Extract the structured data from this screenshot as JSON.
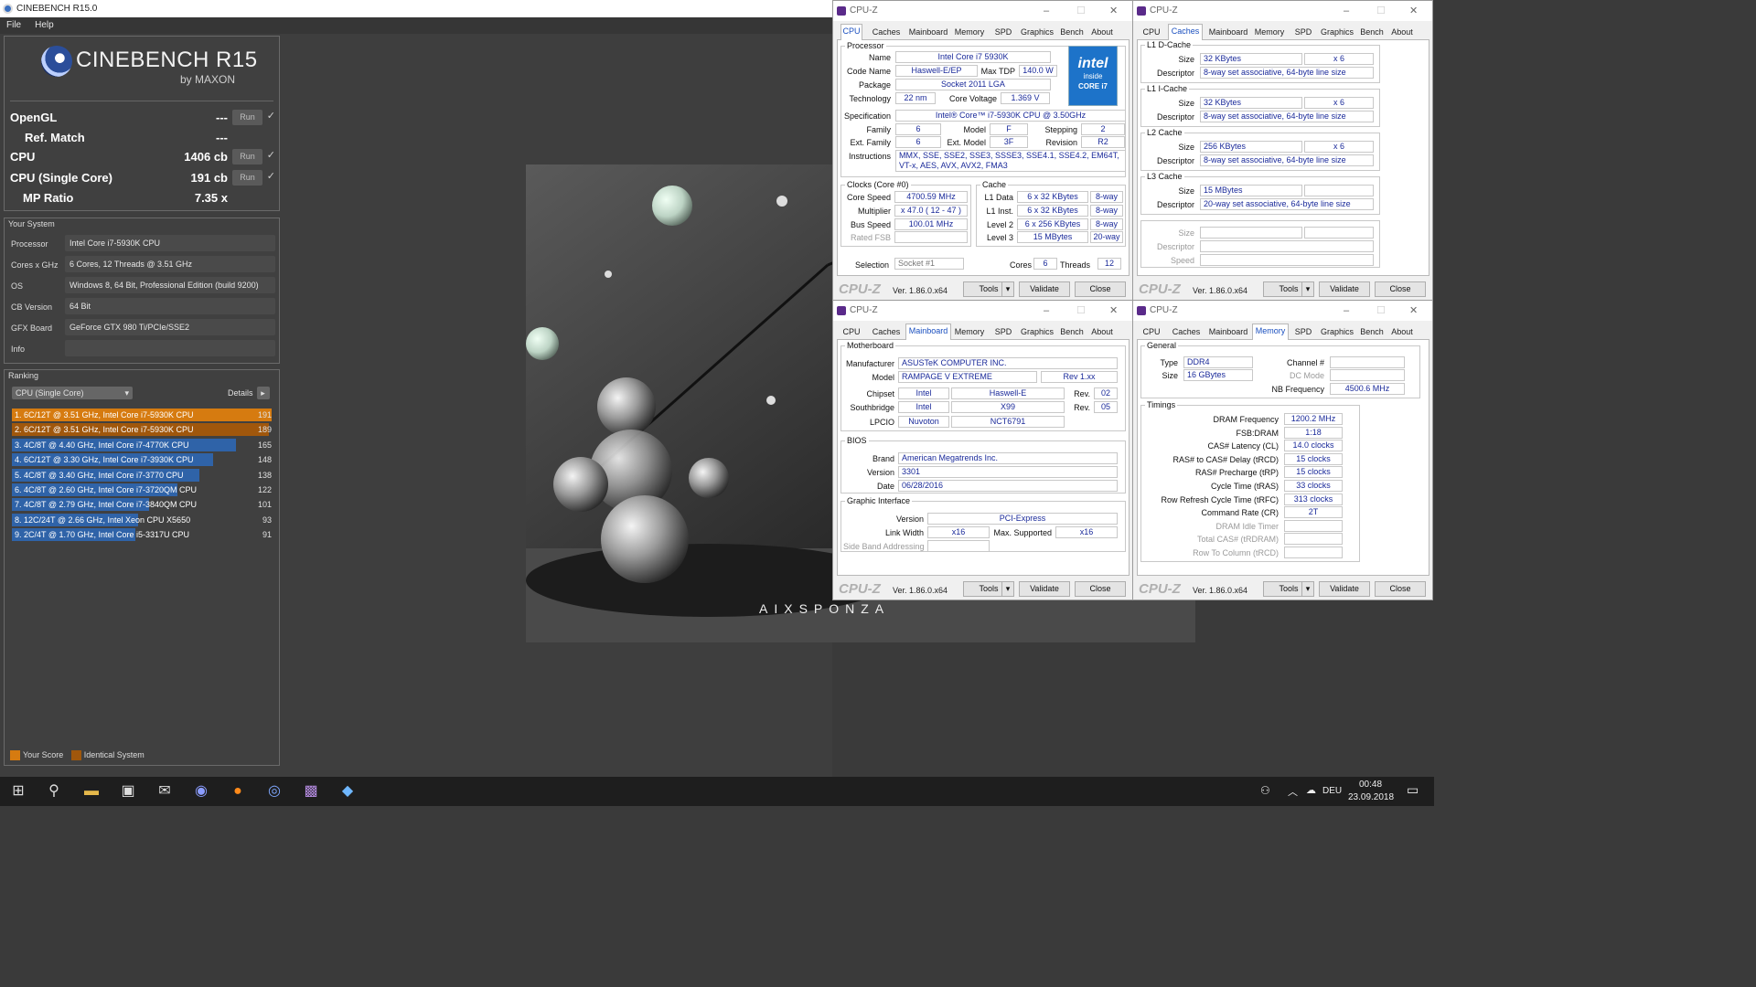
{
  "cinebench": {
    "title": "CINEBENCH R15.0",
    "menu": [
      "File",
      "Help"
    ],
    "logo": {
      "name": "CINEBENCH R15",
      "by": "by MAXON"
    },
    "scores": [
      {
        "label": "OpenGL",
        "value": "---",
        "run": "Run",
        "check": "✓"
      },
      {
        "label": "Ref. Match",
        "value": "---"
      },
      {
        "label": "CPU",
        "value": "1406 cb",
        "run": "Run",
        "check": "✓"
      },
      {
        "label": "CPU (Single Core)",
        "value": "191 cb",
        "run": "Run",
        "check": "✓"
      },
      {
        "label": "MP Ratio",
        "value": "7.35 x"
      }
    ],
    "your_system": {
      "title": "Your System",
      "rows": [
        {
          "k": "Processor",
          "v": "Intel Core i7-5930K CPU"
        },
        {
          "k": "Cores x GHz",
          "v": "6 Cores, 12 Threads @ 3.51 GHz"
        },
        {
          "k": "OS",
          "v": "Windows 8, 64 Bit, Professional Edition (build 9200)"
        },
        {
          "k": "CB Version",
          "v": "64 Bit"
        },
        {
          "k": "GFX Board",
          "v": "GeForce GTX 980 Ti/PCIe/SSE2"
        },
        {
          "k": "Info",
          "v": ""
        }
      ]
    },
    "ranking": {
      "title": "Ranking",
      "dropdown": "CPU (Single Core)",
      "details": "Details",
      "items": [
        {
          "text": "1. 6C/12T @ 3.51 GHz, Intel Core i7-5930K CPU",
          "score": "191",
          "value": 191,
          "kind": "your"
        },
        {
          "text": "2. 6C/12T @ 3.51 GHz, Intel Core i7-5930K CPU",
          "score": "189",
          "value": 189,
          "kind": "identical"
        },
        {
          "text": "3. 4C/8T @ 4.40 GHz, Intel Core i7-4770K CPU",
          "score": "165",
          "value": 165,
          "kind": "other"
        },
        {
          "text": "4. 6C/12T @ 3.30 GHz,  Intel Core i7-3930K CPU",
          "score": "148",
          "value": 148,
          "kind": "other"
        },
        {
          "text": "5. 4C/8T @ 3.40 GHz,  Intel Core i7-3770 CPU",
          "score": "138",
          "value": 138,
          "kind": "other"
        },
        {
          "text": "6. 4C/8T @ 2.60 GHz, Intel Core i7-3720QM CPU",
          "score": "122",
          "value": 122,
          "kind": "other"
        },
        {
          "text": "7. 4C/8T @ 2.79 GHz,  Intel Core i7-3840QM CPU",
          "score": "101",
          "value": 101,
          "kind": "other"
        },
        {
          "text": "8. 12C/24T @ 2.66 GHz, Intel Xeon CPU X5650",
          "score": "93",
          "value": 93,
          "kind": "other"
        },
        {
          "text": "9. 2C/4T @ 1.70 GHz,  Intel Core i5-3317U CPU",
          "score": "91",
          "value": 91,
          "kind": "other"
        }
      ]
    },
    "legend": {
      "your": "Your Score",
      "identical": "Identical System"
    },
    "render_brand": "AIXSPONZA",
    "colors": {
      "your": "#d67b10",
      "identical": "#a0570c",
      "other": "#2f63a8"
    }
  },
  "taskbar": {
    "time": "00:48",
    "date": "23.09.2018",
    "lang": "DEU"
  },
  "cpuz": {
    "title": "CPU-Z",
    "tabs": [
      "CPU",
      "Caches",
      "Mainboard",
      "Memory",
      "SPD",
      "Graphics",
      "Bench",
      "About"
    ],
    "version": "Ver. 1.86.0.x64",
    "logo": "CPU-Z",
    "buttons": {
      "tools": "Tools",
      "validate": "Validate",
      "close": "Close"
    },
    "cpu": {
      "processor_group": "Processor",
      "name_l": "Name",
      "name": "Intel Core i7 5930K",
      "codename_l": "Code Name",
      "codename": "Haswell-E/EP",
      "tdp_l": "Max TDP",
      "tdp": "140.0 W",
      "package_l": "Package",
      "package": "Socket 2011 LGA",
      "tech_l": "Technology",
      "tech": "22 nm",
      "voltage_l": "Core Voltage",
      "voltage": "1.369 V",
      "spec_l": "Specification",
      "spec": "Intel® Core™ i7-5930K CPU @ 3.50GHz",
      "family_l": "Family",
      "family": "6",
      "model_l": "Model",
      "model": "F",
      "stepping_l": "Stepping",
      "stepping": "2",
      "extfamily_l": "Ext. Family",
      "extfamily": "6",
      "extmodel_l": "Ext. Model",
      "extmodel": "3F",
      "revision_l": "Revision",
      "revision": "R2",
      "instr_l": "Instructions",
      "instr": "MMX, SSE, SSE2, SSE3, SSSE3, SSE4.1, SSE4.2, EM64T, VT-x, AES, AVX, AVX2, FMA3",
      "clocks_group": "Clocks (Core #0)",
      "cache_group": "Cache",
      "speed_l": "Core Speed",
      "speed": "4700.59 MHz",
      "mult_l": "Multiplier",
      "mult": "x 47.0 ( 12 - 47 )",
      "bus_l": "Bus Speed",
      "bus": "100.01 MHz",
      "fsb_l": "Rated FSB",
      "l1d_l": "L1 Data",
      "l1d": "6 x 32 KBytes",
      "l1d_w": "8-way",
      "l1i_l": "L1 Inst.",
      "l1i": "6 x 32 KBytes",
      "l1i_w": "8-way",
      "l2_l": "Level 2",
      "l2": "6 x 256 KBytes",
      "l2_w": "8-way",
      "l3_l": "Level 3",
      "l3": "15 MBytes",
      "l3_w": "20-way",
      "sel_l": "Selection",
      "sel": "Socket #1",
      "cores_l": "Cores",
      "cores": "6",
      "threads_l": "Threads",
      "threads": "12",
      "intel_badge": {
        "brand": "intel",
        "inside": "inside",
        "line": "CORE i7"
      }
    },
    "caches": {
      "l1d_group": "L1 D-Cache",
      "l1i_group": "L1 I-Cache",
      "l2_group": "L2 Cache",
      "l3_group": "L3 Cache",
      "size_l": "Size",
      "desc_l": "Descriptor",
      "speed_l": "Speed",
      "l1d_size": "32 KBytes",
      "l1d_x": "x 6",
      "l1d_desc": "8-way set associative, 64-byte line size",
      "l1i_size": "32 KBytes",
      "l1i_x": "x 6",
      "l1i_desc": "8-way set associative, 64-byte line size",
      "l2_size": "256 KBytes",
      "l2_x": "x 6",
      "l2_desc": "8-way set associative, 64-byte line size",
      "l3_size": "15 MBytes",
      "l3_desc": "20-way set associative, 64-byte line size"
    },
    "mainboard": {
      "mb_group": "Motherboard",
      "manu_l": "Manufacturer",
      "manu": "ASUSTeK COMPUTER INC.",
      "model_l": "Model",
      "model": "RAMPAGE V EXTREME",
      "rev": "Rev 1.xx",
      "chipset_l": "Chipset",
      "chipset": "Intel",
      "chipset2": "Haswell-E",
      "rev_l": "Rev.",
      "chipset_rev": "02",
      "sb_l": "Southbridge",
      "sb": "Intel",
      "sb2": "X99",
      "sb_rev": "05",
      "lpcio_l": "LPCIO",
      "lpcio": "Nuvoton",
      "lpcio2": "NCT6791",
      "bios_group": "BIOS",
      "brand_l": "Brand",
      "brand": "American Megatrends Inc.",
      "version_l": "Version",
      "version": "3301",
      "date_l": "Date",
      "date": "06/28/2016",
      "gi_group": "Graphic Interface",
      "giv_l": "Version",
      "giv": "PCI-Express",
      "lw_l": "Link Width",
      "lw": "x16",
      "ms_l": "Max. Supported",
      "ms": "x16",
      "sba_l": "Side Band Addressing"
    },
    "memory": {
      "gen_group": "General",
      "type_l": "Type",
      "type": "DDR4",
      "chan_l": "Channel #",
      "size_l": "Size",
      "size": "16 GBytes",
      "dc_l": "DC Mode",
      "nb_l": "NB Frequency",
      "nb": "4500.6 MHz",
      "tim_group": "Timings",
      "timings": [
        {
          "l": "DRAM Frequency",
          "v": "1200.2 MHz"
        },
        {
          "l": "FSB:DRAM",
          "v": "1:18"
        },
        {
          "l": "CAS# Latency (CL)",
          "v": "14.0 clocks"
        },
        {
          "l": "RAS# to CAS# Delay (tRCD)",
          "v": "15 clocks"
        },
        {
          "l": "RAS# Precharge (tRP)",
          "v": "15 clocks"
        },
        {
          "l": "Cycle Time (tRAS)",
          "v": "33 clocks"
        },
        {
          "l": "Row Refresh Cycle Time (tRFC)",
          "v": "313 clocks"
        },
        {
          "l": "Command Rate (CR)",
          "v": "2T"
        },
        {
          "l": "DRAM Idle Timer",
          "v": ""
        },
        {
          "l": "Total CAS# (tRDRAM)",
          "v": ""
        },
        {
          "l": "Row To Column (tRCD)",
          "v": ""
        }
      ]
    }
  }
}
